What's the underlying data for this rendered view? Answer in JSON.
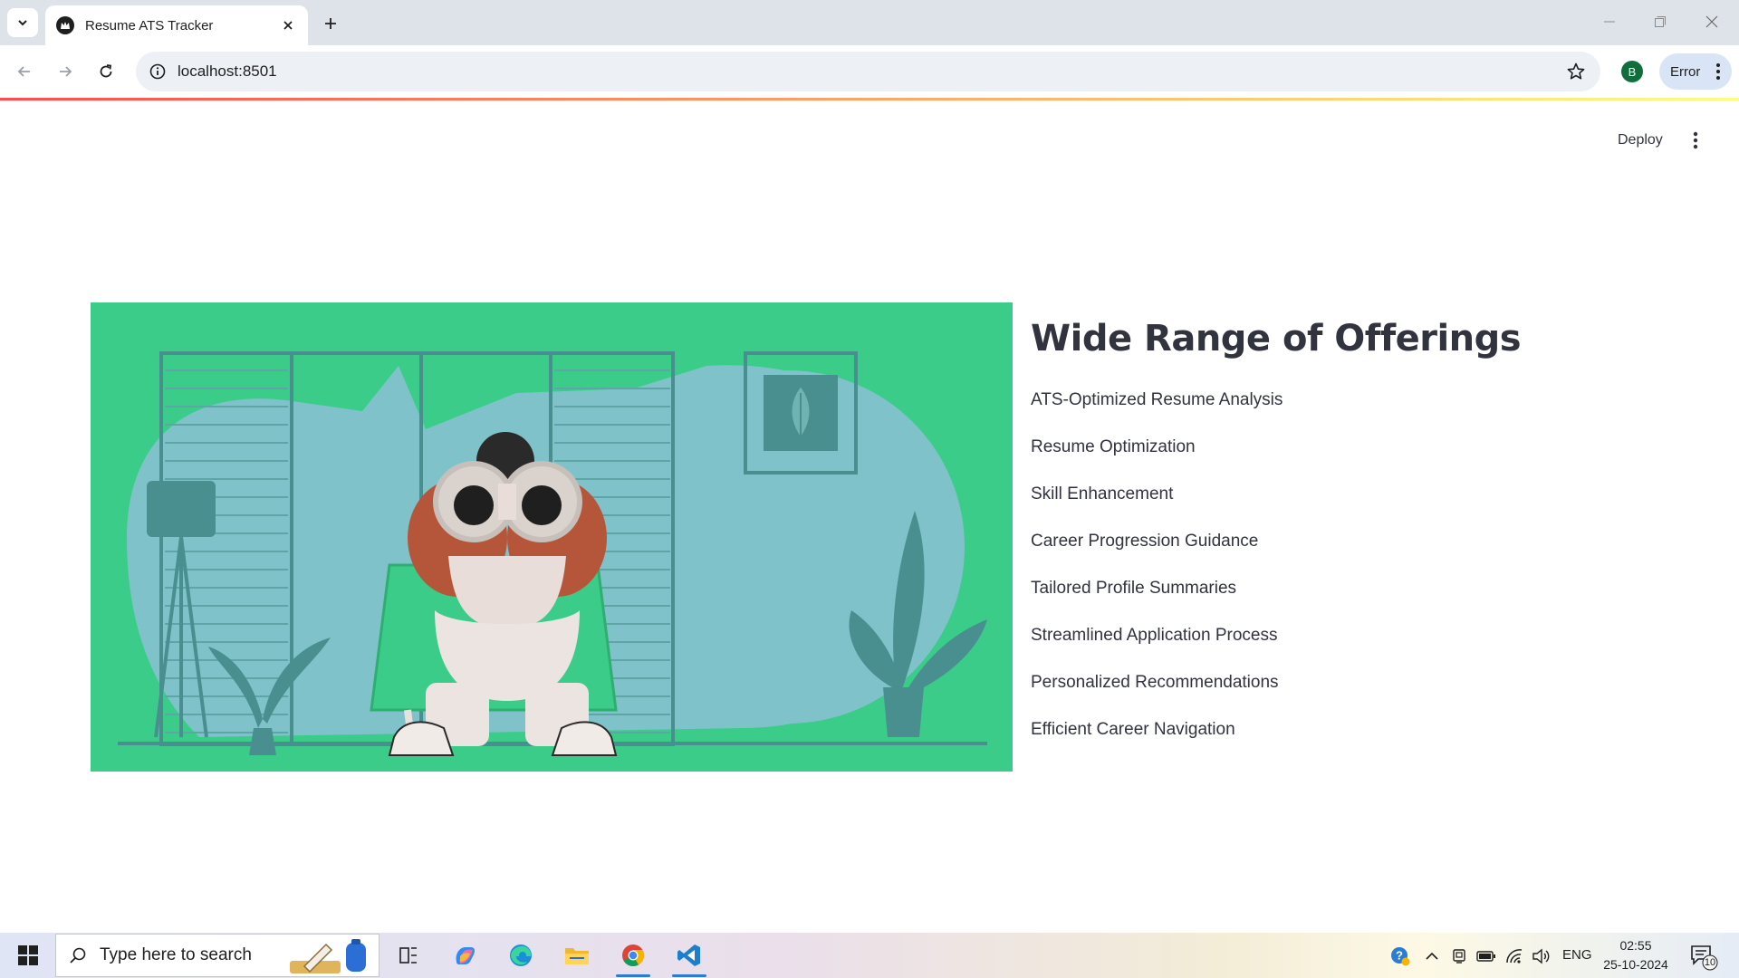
{
  "browser": {
    "tab_title": "Resume ATS Tracker",
    "url": "localhost:8501",
    "profile_initial": "B",
    "error_label": "Error"
  },
  "app": {
    "deploy_label": "Deploy",
    "heading": "Wide Range of Offerings",
    "offerings": [
      "ATS-Optimized Resume Analysis",
      "Resume Optimization",
      "Skill Enhancement",
      "Career Progression Guidance",
      "Tailored Profile Summaries",
      "Streamlined Application Process",
      "Personalized Recommendations",
      "Efficient Career Navigation"
    ]
  },
  "taskbar": {
    "search_placeholder": "Type here to search",
    "language": "ENG",
    "time": "02:55",
    "date": "25-10-2024",
    "notification_count": "10"
  },
  "colors": {
    "hero_green": "#3ccc8a",
    "hero_blue": "#7fc2c9",
    "text": "#31333f",
    "accent_red": "#ff4b4b"
  }
}
